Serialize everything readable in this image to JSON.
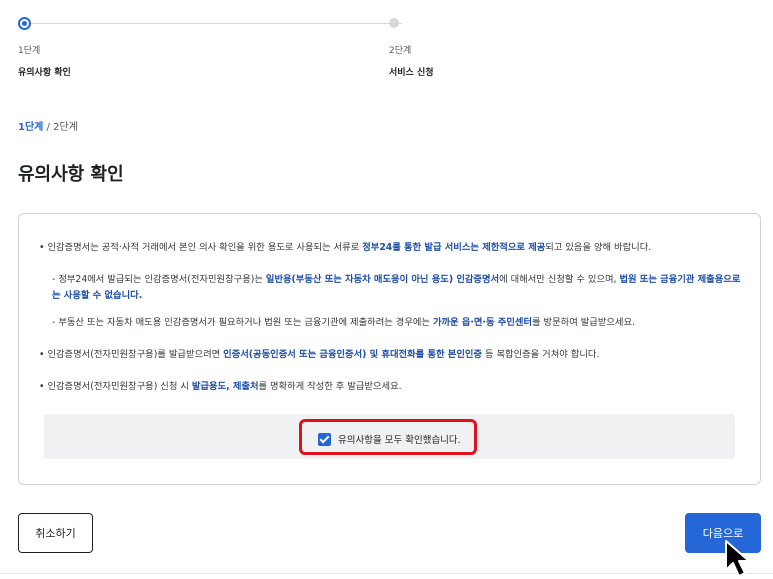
{
  "stepper": {
    "steps": [
      {
        "num": "1단계",
        "name": "유의사항 확인"
      },
      {
        "num": "2단계",
        "name": "서비스 신청"
      }
    ]
  },
  "progress": {
    "current": "1단계",
    "sep": " / ",
    "total": "2단계"
  },
  "page_title": "유의사항 확인",
  "notice": {
    "b1": {
      "pre": "인감증명서는 공적·사적 거래에서 본인 의사 확인을 위한 용도로 사용되는 서류로 ",
      "em": "정부24를 통한 발급 서비스는 제한적으로 제공",
      "post": "되고 있음을 양해 바랍니다."
    },
    "s1": {
      "pre": "정부24에서 발급되는 인감증명서(전자민원창구용)는 ",
      "em1": "일반용(부동산 또는 자동차 매도용이 아닌 용도) 인감증명서",
      "mid": "에 대해서만 신청할 수 있으며, ",
      "em2": "법원 또는 금융기관 제출용으로는 사용할 수 없습니다."
    },
    "s2": {
      "pre": "부동산 또는 자동차 매도용 인감증명서가 필요하거나 법원 또는 금융기관에 제출하려는 경우에는 ",
      "em": "가까운 읍·면·동 주민센터",
      "post": "를 방문하여 발급받으세요."
    },
    "b2": {
      "pre": "인감증명서(전자민원창구용)를 발급받으려면 ",
      "em": "인증서(공동인증서 또는 금융인증서) 및 휴대전화를 통한 본인인증",
      "post": " 등 복합인증을 거쳐야 합니다."
    },
    "b3": {
      "pre": "인감증명서(전자민원창구용) 신청 시 ",
      "em": "발급용도, 제출처",
      "post": "를 명확하게 작성한 후 발급받으세요."
    },
    "confirm_label": "유의사항을 모두 확인했습니다.",
    "confirm_checked": true
  },
  "buttons": {
    "cancel": "취소하기",
    "next": "다음으로"
  },
  "colors": {
    "accent": "#2667d8",
    "highlight": "#e2101e",
    "emphasis": "#1f4fa8"
  }
}
